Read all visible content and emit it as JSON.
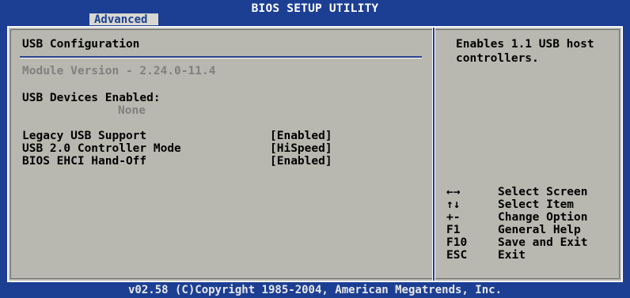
{
  "header": {
    "title": "BIOS SETUP UTILITY",
    "active_tab": "Advanced"
  },
  "main": {
    "section_title": "USB Configuration",
    "module_version": "Module Version - 2.24.0-11.4",
    "devices_label": "USB Devices Enabled:",
    "devices_value": "None",
    "options": [
      {
        "label": "Legacy USB Support",
        "value": "[Enabled]"
      },
      {
        "label": "USB 2.0 Controller Mode",
        "value": "[HiSpeed]"
      },
      {
        "label": "BIOS EHCI Hand-Off",
        "value": "[Enabled]"
      }
    ]
  },
  "help": {
    "text": "Enables 1.1 USB host controllers."
  },
  "keys": [
    {
      "key": "←→",
      "desc": "Select Screen",
      "icon": "left-right-arrows-icon"
    },
    {
      "key": "↑↓",
      "desc": "Select Item",
      "icon": "up-down-arrows-icon"
    },
    {
      "key": "+-",
      "desc": "Change Option",
      "icon": ""
    },
    {
      "key": "F1",
      "desc": "General Help",
      "icon": ""
    },
    {
      "key": "F10",
      "desc": "Save and Exit",
      "icon": ""
    },
    {
      "key": "ESC",
      "desc": "Exit",
      "icon": ""
    }
  ],
  "footer": {
    "copyright": "v02.58 (C)Copyright 1985-2004, American Megatrends, Inc."
  },
  "colors": {
    "background": "#1c3f94",
    "panel": "#b8b8b0",
    "tab": "#d8d8d0",
    "dim_text": "#808080"
  }
}
